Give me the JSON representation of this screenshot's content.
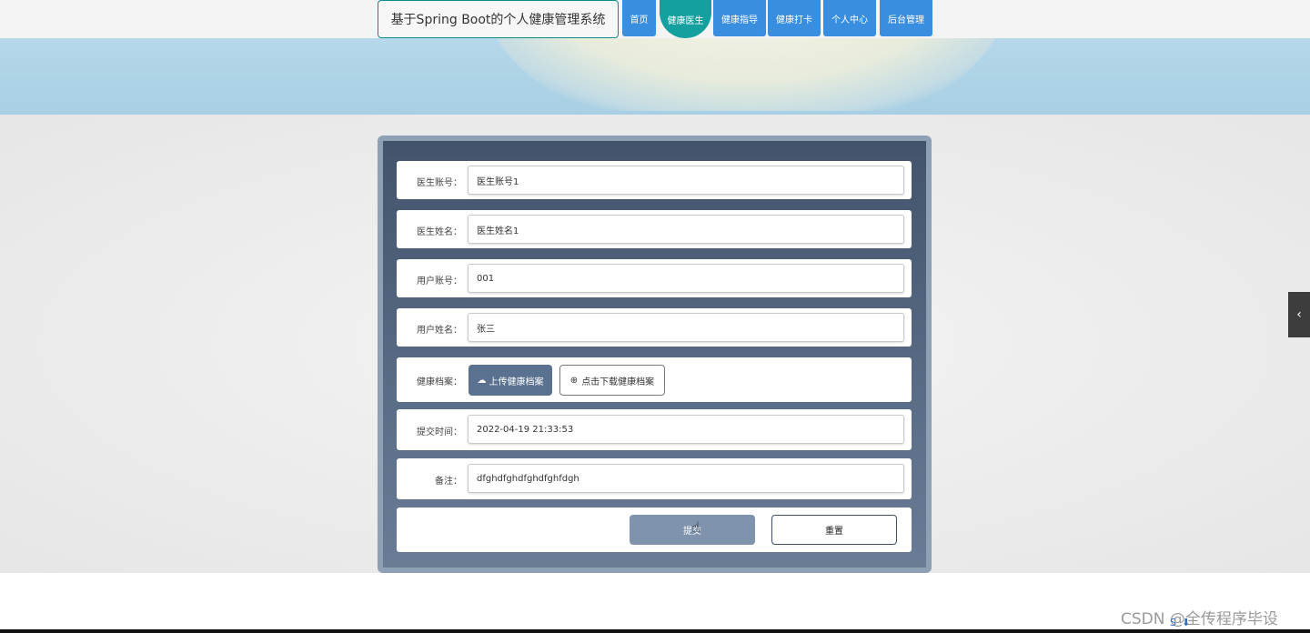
{
  "header": {
    "site_title": "基于Spring Boot的个人健康管理系统",
    "nav": [
      {
        "label": "首页"
      },
      {
        "label": "健康医生"
      },
      {
        "label": "健康指导"
      },
      {
        "label": "健康打卡"
      },
      {
        "label": "个人中心"
      },
      {
        "label": "后台管理"
      }
    ],
    "active_nav": "健康医生"
  },
  "form": {
    "doctor_account": {
      "label": "医生账号：",
      "value": "医生账号1"
    },
    "doctor_name": {
      "label": "医生姓名：",
      "value": "医生姓名1"
    },
    "user_account": {
      "label": "用户账号：",
      "value": "001"
    },
    "user_name": {
      "label": "用户姓名：",
      "value": "张三"
    },
    "health_file": {
      "label": "健康档案：",
      "upload_label": "上传健康档案",
      "download_label": "点击下载健康档案"
    },
    "submit_time": {
      "label": "提交时间：",
      "value": "2022-04-19 21:33:53"
    },
    "remark": {
      "label": "备注：",
      "value": "dfghdfghdfghdfghfdgh"
    },
    "submit_label": "提交",
    "reset_label": "重置"
  },
  "colors": {
    "nav_button": "#3a8ee0",
    "nav_active": "#15a0a0",
    "panel_bg": "#4f6079",
    "upload_button": "#5a7290",
    "submit_button": "#7f93ad"
  },
  "watermark": "CSDN @全传程序毕设"
}
